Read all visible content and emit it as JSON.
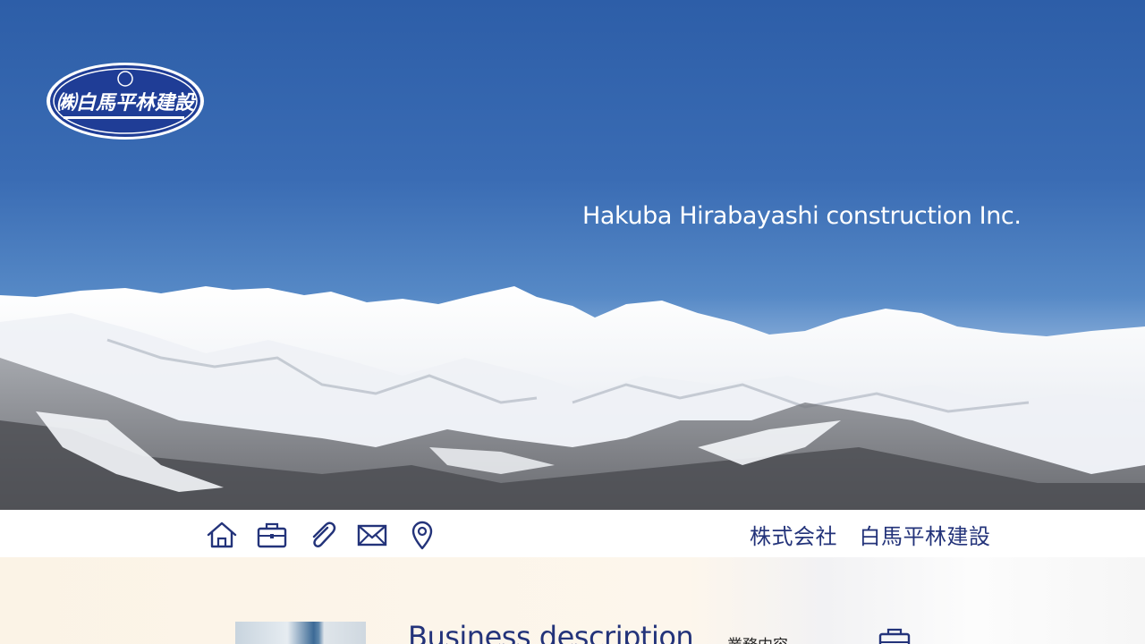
{
  "brand": {
    "logo_text": "㈱白馬平林建設",
    "tagline": "Hakuba Hirabayashi construction Inc.",
    "company_name_jp": "株式会社　白馬平林建設"
  },
  "nav": {
    "icons": [
      "home-icon",
      "briefcase-icon",
      "paperclip-icon",
      "mail-icon",
      "map-pin-icon"
    ]
  },
  "business": {
    "title": "Business description",
    "title_jp": "業務内容",
    "icon": "briefcase-icon"
  },
  "colors": {
    "navy": "#23337a",
    "sky": "#3a6cb4",
    "logo_blue": "#1f3d96"
  }
}
